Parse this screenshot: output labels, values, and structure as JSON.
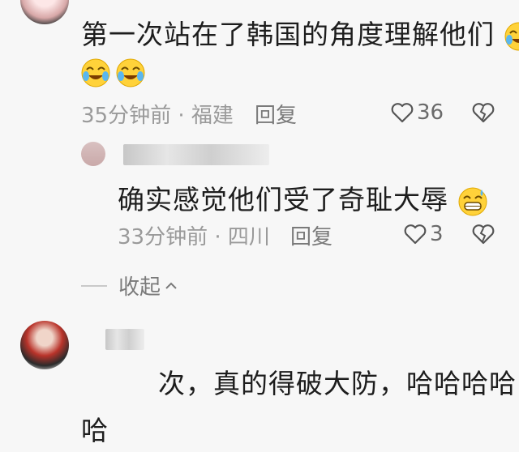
{
  "comments": [
    {
      "text": "第一次站在了韩国的角度理解他们",
      "time": "35分钟前",
      "location": "福建",
      "reply_label": "回复",
      "likes": "36",
      "replies": [
        {
          "text": "确实感觉他们受了奇耻大辱",
          "time": "33分钟前",
          "location": "四川",
          "reply_label": "回复",
          "likes": "3"
        }
      ],
      "collapse_label": "收起"
    },
    {
      "text_line1": "次，真的得破大防，哈哈哈哈",
      "text_line2": "哈"
    }
  ],
  "meta_separator": "·",
  "icons": {
    "emoji": "laugh-crying-emoji",
    "emoji_sweat": "grinning-sweat-emoji",
    "like": "heart-outline-icon",
    "dislike": "broken-heart-icon",
    "collapse": "chevron-up-icon"
  },
  "colors": {
    "background": "#f7f7f7",
    "text": "#1d1d1d",
    "meta": "#9a9a9a"
  }
}
